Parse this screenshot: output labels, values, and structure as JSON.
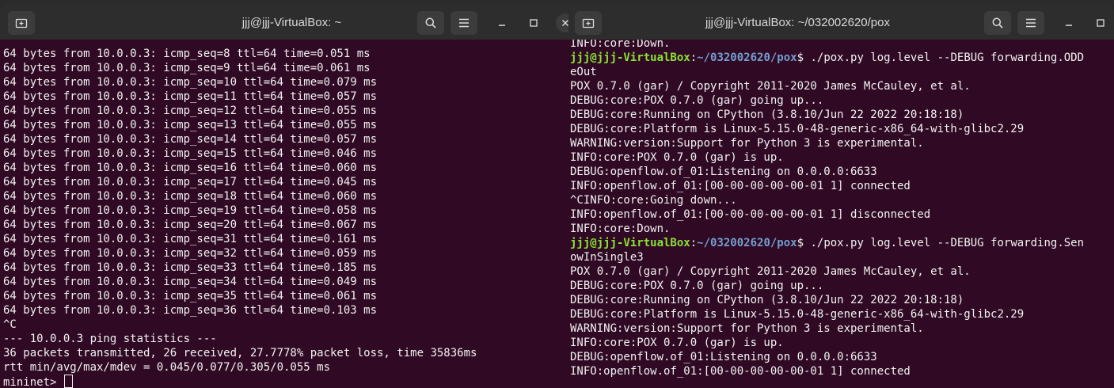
{
  "left_window": {
    "title": "jjj@jjj-VirtualBox: ~",
    "lines": [
      "64 bytes from 10.0.0.3: icmp_seq=8 ttl=64 time=0.051 ms",
      "64 bytes from 10.0.0.3: icmp_seq=9 ttl=64 time=0.061 ms",
      "64 bytes from 10.0.0.3: icmp_seq=10 ttl=64 time=0.079 ms",
      "64 bytes from 10.0.0.3: icmp_seq=11 ttl=64 time=0.057 ms",
      "64 bytes from 10.0.0.3: icmp_seq=12 ttl=64 time=0.055 ms",
      "64 bytes from 10.0.0.3: icmp_seq=13 ttl=64 time=0.055 ms",
      "64 bytes from 10.0.0.3: icmp_seq=14 ttl=64 time=0.057 ms",
      "64 bytes from 10.0.0.3: icmp_seq=15 ttl=64 time=0.046 ms",
      "64 bytes from 10.0.0.3: icmp_seq=16 ttl=64 time=0.060 ms",
      "64 bytes from 10.0.0.3: icmp_seq=17 ttl=64 time=0.045 ms",
      "64 bytes from 10.0.0.3: icmp_seq=18 ttl=64 time=0.060 ms",
      "64 bytes from 10.0.0.3: icmp_seq=19 ttl=64 time=0.058 ms",
      "64 bytes from 10.0.0.3: icmp_seq=20 ttl=64 time=0.067 ms",
      "64 bytes from 10.0.0.3: icmp_seq=31 ttl=64 time=0.161 ms",
      "64 bytes from 10.0.0.3: icmp_seq=32 ttl=64 time=0.059 ms",
      "64 bytes from 10.0.0.3: icmp_seq=33 ttl=64 time=0.185 ms",
      "64 bytes from 10.0.0.3: icmp_seq=34 ttl=64 time=0.049 ms",
      "64 bytes from 10.0.0.3: icmp_seq=35 ttl=64 time=0.061 ms",
      "64 bytes from 10.0.0.3: icmp_seq=36 ttl=64 time=0.103 ms",
      "^C",
      "--- 10.0.0.3 ping statistics ---",
      "36 packets transmitted, 26 received, 27.7778% packet loss, time 35836ms",
      "rtt min/avg/max/mdev = 0.045/0.077/0.305/0.055 ms"
    ],
    "prompt": "mininet> "
  },
  "right_window": {
    "title": "jjj@jjj-VirtualBox: ~/032002620/pox",
    "user_host": "jjj@jjj-VirtualBox",
    "colon": ":",
    "path": "~/032002620/pox",
    "dollar": "$",
    "lines_a": [
      "INFO:core:Down."
    ],
    "command_1": " ./pox.py log.level --DEBUG forwarding.ODD",
    "command_1_wrap": "eOut",
    "lines_b": [
      "POX 0.7.0 (gar) / Copyright 2011-2020 James McCauley, et al.",
      "DEBUG:core:POX 0.7.0 (gar) going up...",
      "DEBUG:core:Running on CPython (3.8.10/Jun 22 2022 20:18:18)",
      "DEBUG:core:Platform is Linux-5.15.0-48-generic-x86_64-with-glibc2.29",
      "WARNING:version:Support for Python 3 is experimental.",
      "INFO:core:POX 0.7.0 (gar) is up.",
      "DEBUG:openflow.of_01:Listening on 0.0.0.0:6633",
      "INFO:openflow.of_01:[00-00-00-00-00-01 1] connected",
      "^CINFO:core:Going down...",
      "INFO:openflow.of_01:[00-00-00-00-00-01 1] disconnected",
      "INFO:core:Down."
    ],
    "command_2": " ./pox.py log.level --DEBUG forwarding.Sen",
    "command_2_wrap": "owInSingle3",
    "lines_c": [
      "POX 0.7.0 (gar) / Copyright 2011-2020 James McCauley, et al.",
      "DEBUG:core:POX 0.7.0 (gar) going up...",
      "DEBUG:core:Running on CPython (3.8.10/Jun 22 2022 20:18:18)",
      "DEBUG:core:Platform is Linux-5.15.0-48-generic-x86_64-with-glibc2.29",
      "WARNING:version:Support for Python 3 is experimental.",
      "INFO:core:POX 0.7.0 (gar) is up.",
      "DEBUG:openflow.of_01:Listening on 0.0.0.0:6633",
      "INFO:openflow.of_01:[00-00-00-00-00-01 1] connected"
    ]
  },
  "icons": {
    "new_tab": "new-tab-icon",
    "search": "search-icon",
    "menu": "hamburger-menu-icon",
    "minimize": "minimize-icon",
    "maximize": "maximize-icon",
    "close": "close-icon"
  },
  "colors": {
    "terminal_bg": "#300a24",
    "titlebar_bg": "#2d2d2d",
    "prompt_user": "#8ae234",
    "prompt_path": "#729fcf",
    "text": "#f2f2f2"
  }
}
